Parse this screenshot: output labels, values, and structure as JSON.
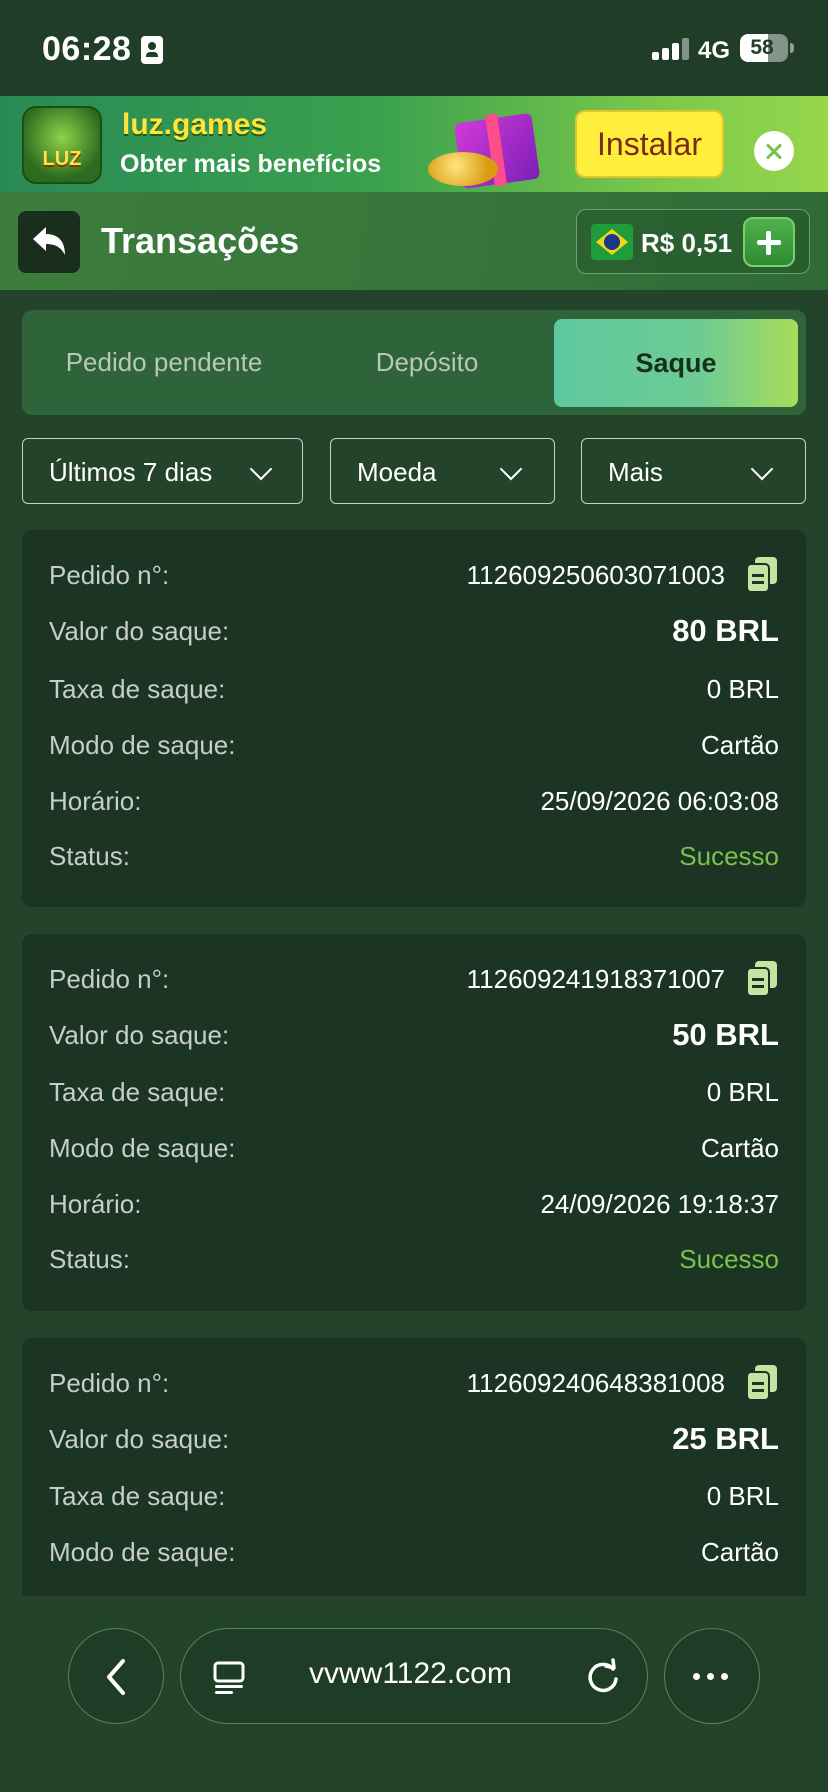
{
  "status_bar": {
    "time": "06:28",
    "network": "4G",
    "battery": "58",
    "battery_level": 0.58
  },
  "banner": {
    "title": "luz.games",
    "subtitle": "Obter mais benefícios",
    "install_label": "Instalar",
    "logo_text": "LUZ"
  },
  "header": {
    "title": "Transações",
    "balance": "R$ 0,51"
  },
  "tabs": [
    {
      "label": "Pedido pendente",
      "active": false
    },
    {
      "label": "Depósito",
      "active": false
    },
    {
      "label": "Saque",
      "active": true
    }
  ],
  "filters": [
    {
      "label": "Últimos 7 dias"
    },
    {
      "label": "Moeda"
    },
    {
      "label": "Mais"
    }
  ],
  "labels": {
    "order": "Pedido n°:",
    "amount": "Valor do saque:",
    "fee": "Taxa de saque:",
    "mode": "Modo de saque:",
    "time": "Horário:",
    "status": "Status:"
  },
  "transactions": [
    {
      "order": "112609250603071003",
      "amount": "80 BRL",
      "fee": "0 BRL",
      "mode": "Cartão",
      "time": "25/09/2026 06:03:08",
      "status": "Sucesso"
    },
    {
      "order": "112609241918371007",
      "amount": "50 BRL",
      "fee": "0 BRL",
      "mode": "Cartão",
      "time": "24/09/2026 19:18:37",
      "status": "Sucesso"
    },
    {
      "order": "112609240648381008",
      "amount": "25 BRL",
      "fee": "0 BRL",
      "mode": "Cartão"
    }
  ],
  "browser": {
    "url": "vvww1122.com"
  },
  "colors": {
    "success": "#7bc24a",
    "accent": "#5ec8a0",
    "background": "#24432b",
    "card": "#1b3423"
  }
}
